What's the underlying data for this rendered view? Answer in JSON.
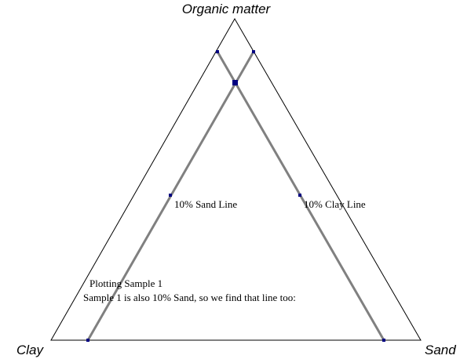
{
  "diagram": {
    "vertices": {
      "top": "Organic matter",
      "left": "Clay",
      "right": "Sand"
    },
    "lines": {
      "sand_line": "10% Sand Line",
      "clay_line": "10% Clay Line"
    },
    "caption": {
      "line1": "Plotting Sample 1",
      "line2": "Sample 1 is also 10% Sand, so we find that line too:"
    },
    "colors": {
      "outline": "#000000",
      "guide_line": "#808080",
      "marker": "#000080"
    }
  }
}
